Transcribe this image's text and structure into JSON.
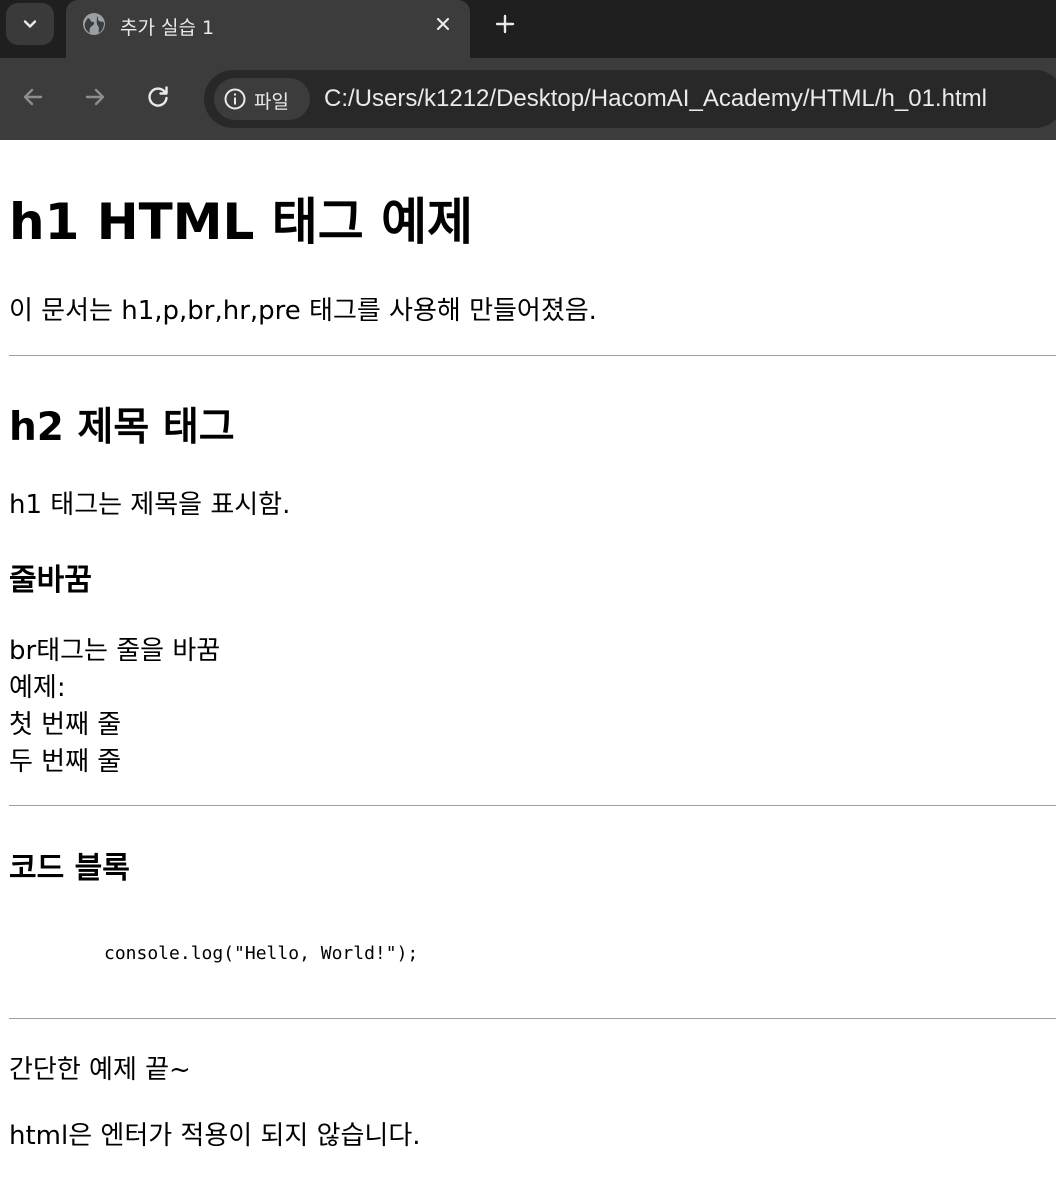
{
  "browser": {
    "tab": {
      "title": "추가 실습 1"
    },
    "site_chip_label": "파일",
    "url": "C:/Users/k1212/Desktop/HacomAI_Academy/HTML/h_01.html",
    "icons": [
      "tab-search-icon",
      "globe-icon",
      "close-icon",
      "plus-icon",
      "back-arrow-icon",
      "forward-arrow-icon",
      "reload-icon",
      "info-icon"
    ],
    "colors": {
      "tabbar": "#1f1f1f",
      "toolbar": "#3c3c3c",
      "omnibox": "#282828",
      "text": "#e8eaed"
    }
  },
  "page": {
    "h1": "h1 HTML 태그 예제",
    "intro": "이 문서는 h1,p,br,hr,pre 태그를 사용해 만들어졌음.",
    "section1": {
      "heading": "h2 제목 태그",
      "text": "h1 태그는 제목을 표시함."
    },
    "section2": {
      "heading": "줄바꿈",
      "lines": [
        "br태그는 줄을 바꿈",
        "예제:",
        "첫 번째 줄",
        "두 번째 줄"
      ]
    },
    "section3": {
      "heading": "코드 블록",
      "code": "console.log(\"Hello, World!\");"
    },
    "outro": {
      "line1": "간단한 예제 끝~",
      "line2": "html은 엔터가 적용이 되지 않습니다."
    }
  }
}
